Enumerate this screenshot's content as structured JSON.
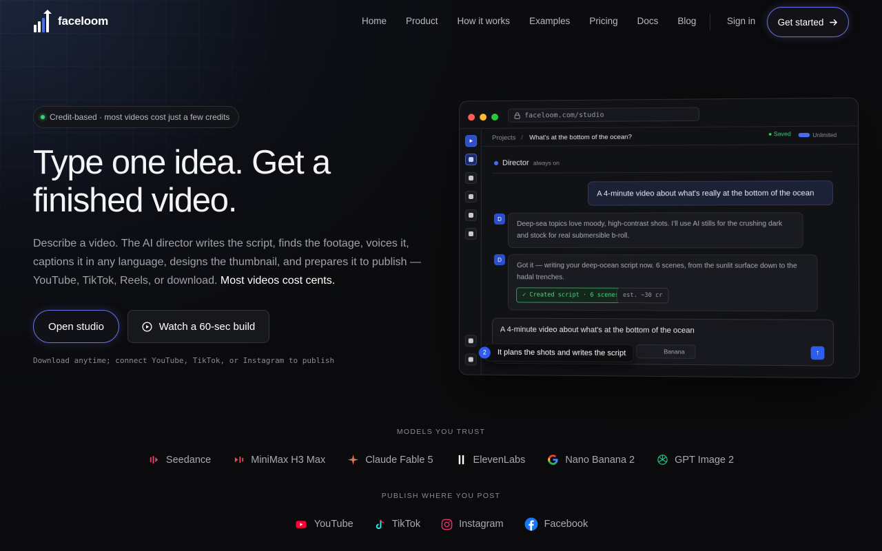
{
  "nav": {
    "brand": "faceloom",
    "links": [
      "Home",
      "Product",
      "How it works",
      "Examples",
      "Pricing",
      "Docs",
      "Blog"
    ],
    "sign_in": "Sign in",
    "get_started": "Get started"
  },
  "hero": {
    "pill": "Credit-based · most videos cost just a few credits",
    "headline": "Type one idea. Get a finished video.",
    "description": "Describe a video. The AI director writes the script, finds the footage, voices it, captions it in any language, designs the thumbnail, and prepares it to publish — YouTube, TikTok, Reels, or download.",
    "description_highlight": "Most videos cost cents.",
    "open_studio": "Open studio",
    "watch_build": "Watch a 60-sec build",
    "note": "Download anytime; connect YouTube, TikTok, or Instagram to publish"
  },
  "studio": {
    "url": "faceloom.com/studio",
    "crumb_projects": "Projects",
    "crumb_sep": "/",
    "project_title": "What's at the bottom of the ocean?",
    "saved": "● Saved",
    "unlimited": "Unlimited",
    "director": "Director",
    "director_status": "always on",
    "user_message": "A 4-minute video about what's really at the bottom of the ocean",
    "bot_messages": [
      {
        "avatar": "D",
        "text": "Deep-sea topics love moody, high-contrast shots. I'll use AI stills for the crushing dark and stock for real submersible b-roll."
      },
      {
        "avatar": "D",
        "text": "Got it — writing your deep-ocean script now. 6 scenes, from the sunlit surface down to the hadal trenches."
      }
    ],
    "chip_created": "✓ Created script · 6 scenes",
    "chip_estimate": "est. ~30 cr",
    "composer_text": "A 4-minute video about what's at the bottom of the ocean",
    "composer_model": "Banana",
    "tooltip_step": "2",
    "tooltip_text": "It plans the shots and writes the script"
  },
  "models": {
    "label": "MODELS YOU TRUST",
    "items": [
      {
        "name": "Seedance",
        "icon": "seedance-icon",
        "color": "#e0466b"
      },
      {
        "name": "MiniMax H3 Max",
        "icon": "minimax-icon",
        "color": "#e8465a"
      },
      {
        "name": "Claude Fable 5",
        "icon": "claude-icon",
        "color": "#d97757"
      },
      {
        "name": "ElevenLabs",
        "icon": "elevenlabs-icon",
        "color": "#ffffff"
      },
      {
        "name": "Nano Banana 2",
        "icon": "google-icon",
        "color": "#4285f4"
      },
      {
        "name": "GPT Image 2",
        "icon": "openai-icon",
        "color": "#19c37d"
      }
    ]
  },
  "publish": {
    "label": "PUBLISH WHERE YOU POST",
    "items": [
      {
        "name": "YouTube",
        "icon": "youtube-icon",
        "color": "#ff0033"
      },
      {
        "name": "TikTok",
        "icon": "tiktok-icon",
        "color": "#25f4ee"
      },
      {
        "name": "Instagram",
        "icon": "instagram-icon",
        "color": "#e1306c"
      },
      {
        "name": "Facebook",
        "icon": "facebook-icon",
        "color": "#1877f2"
      }
    ]
  }
}
